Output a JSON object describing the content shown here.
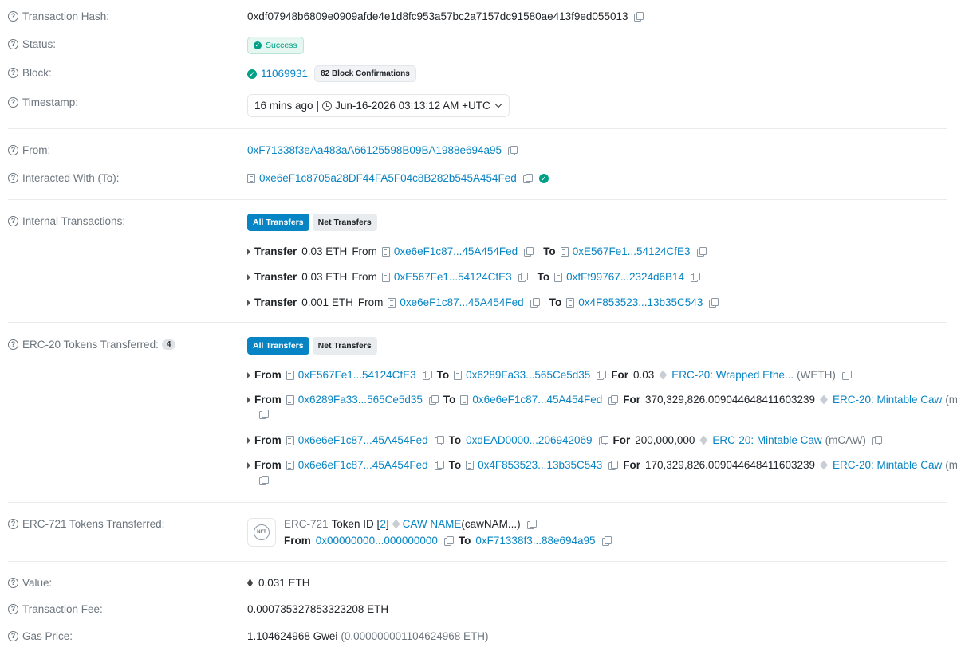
{
  "tx_hash": {
    "label": "Transaction Hash:",
    "value": "0xdf07948b6809e0909afde4e1d8fc953a57bc2a7157dc91580ae413f9ed055013"
  },
  "status": {
    "label": "Status:",
    "value": "Success"
  },
  "block": {
    "label": "Block:",
    "number": "11069931",
    "confirmations": "82 Block Confirmations"
  },
  "timestamp": {
    "label": "Timestamp:",
    "ago": "16 mins ago",
    "separator": "|",
    "datetime": "Jun-16-2026 03:13:12 AM +UTC"
  },
  "from": {
    "label": "From:",
    "address": "0xF71338f3eAa483aA66125598B09BA1988e694a95"
  },
  "to": {
    "label": "Interacted With (To):",
    "address": "0xe6eF1c8705a28DF44FA5F04c8B282b545A454Fed"
  },
  "internal": {
    "label": "Internal Transactions:",
    "tabs": [
      "All Transfers",
      "Net Transfers"
    ],
    "rows": [
      {
        "kw": "Transfer",
        "amount": "0.03 ETH",
        "from_kw": "From",
        "from": "0xe6eF1c87...45A454Fed",
        "to_kw": "To",
        "to": "0xE567Fe1...54124CfE3"
      },
      {
        "kw": "Transfer",
        "amount": "0.03 ETH",
        "from_kw": "From",
        "from": "0xE567Fe1...54124CfE3",
        "to_kw": "To",
        "to": "0xfFf99767...2324d6B14"
      },
      {
        "kw": "Transfer",
        "amount": "0.001 ETH",
        "from_kw": "From",
        "from": "0xe6eF1c87...45A454Fed",
        "to_kw": "To",
        "to": "0x4F853523...13b35C543"
      }
    ]
  },
  "erc20": {
    "label": "ERC-20 Tokens Transferred:",
    "count": "4",
    "tabs": [
      "All Transfers",
      "Net Transfers"
    ],
    "rows": [
      {
        "from_kw": "From",
        "from": "0xE567Fe1...54124CfE3",
        "to_kw": "To",
        "to": "0x6289Fa33...565Ce5d35",
        "for_kw": "For",
        "amount": "0.03",
        "token": "ERC-20: Wrapped Ethe...",
        "symbol": "(WETH)"
      },
      {
        "from_kw": "From",
        "from": "0x6289Fa33...565Ce5d35",
        "to_kw": "To",
        "to": "0x6e6eF1c87...45A454Fed",
        "for_kw": "For",
        "amount": "370,329,826.009044648411603239",
        "token": "ERC-20: Mintable Caw",
        "symbol": "(mCAW)"
      },
      {
        "from_kw": "From",
        "from": "0x6e6eF1c87...45A454Fed",
        "to_kw": "To",
        "to": "0xdEAD0000...206942069",
        "for_kw": "For",
        "amount": "200,000,000",
        "token": "ERC-20: Mintable Caw",
        "symbol": "(mCAW)"
      },
      {
        "from_kw": "From",
        "from": "0x6e6eF1c87...45A454Fed",
        "to_kw": "To",
        "to": "0x4F853523...13b35C543",
        "for_kw": "For",
        "amount": "170,329,826.009044648411603239",
        "token": "ERC-20: Mintable Caw",
        "symbol": "(mCAW)"
      }
    ]
  },
  "erc721": {
    "label": "ERC-721 Tokens Transferred:",
    "thumb": "NFT",
    "standard": "ERC-721",
    "token_id_kw": "Token ID [",
    "token_id": "2",
    "token_id_close": "]",
    "name": "CAW NAME",
    "name_suffix": "(cawNAM...)",
    "from_kw": "From",
    "from": "0x00000000...000000000",
    "to_kw": "To",
    "to": "0xF71338f3...88e694a95"
  },
  "value": {
    "label": "Value:",
    "amount": "0.031 ETH"
  },
  "fee": {
    "label": "Transaction Fee:",
    "amount": "0.000735327853323208 ETH"
  },
  "gas": {
    "label": "Gas Price:",
    "gwei": "1.104624968 Gwei",
    "eth": "(0.000000001104624968 ETH)"
  },
  "icons": [
    "question-circle-icon",
    "copy-icon",
    "check-circle-icon",
    "clock-icon",
    "chevron-down-icon",
    "contract-doc-icon",
    "token-icon",
    "eth-icon",
    "caret-right-icon"
  ],
  "colors": {
    "link": "#0784c3",
    "success": "#00a186",
    "label": "#6c757d",
    "button_active": "#0784c3"
  }
}
